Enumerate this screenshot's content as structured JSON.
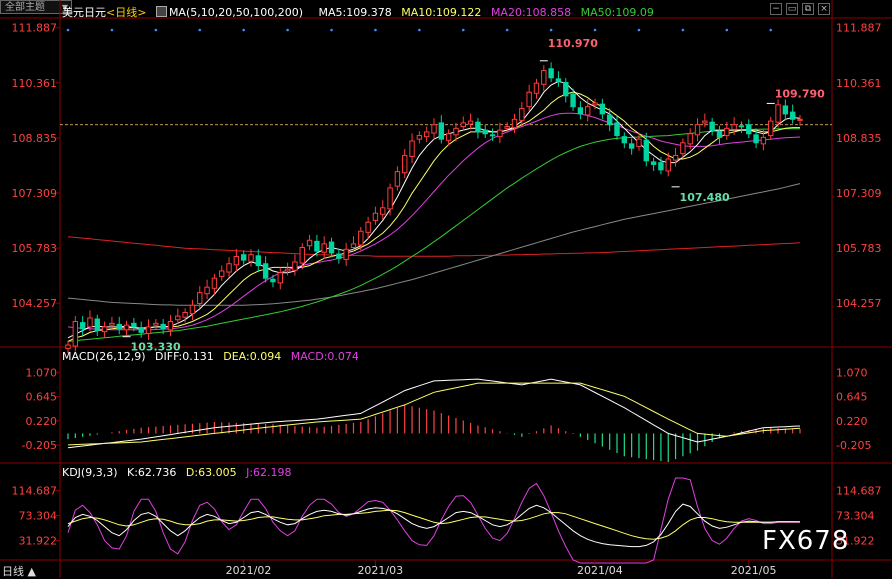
{
  "header": {
    "symbol": "美元日元",
    "period": "<日线>",
    "ma_params": "MA(5,10,20,50,100,200)",
    "ma5": "MA5:109.378",
    "ma10": "MA10:109.122",
    "ma20": "MA20:108.858",
    "ma50": "MA50:109.09",
    "theme_button": "全部主题",
    "theme_caret": "▼"
  },
  "macd_header": {
    "title": "MACD(26,12,9)",
    "diff": "DIFF:0.131",
    "dea": "DEA:0.094",
    "macd": "MACD:0.074"
  },
  "kdj_header": {
    "title": "KDJ(9,3,3)",
    "k": "K:62.736",
    "d": "D:63.005",
    "j": "J:62.198"
  },
  "period_tab": "日线 ▲",
  "watermark": "FX678",
  "colors": {
    "up": "#ff3b3b",
    "down": "#00d4a0",
    "ma5": "#ffffff",
    "ma10": "#ffff66",
    "ma20": "#e040e0",
    "ma50": "#33cc33",
    "ma100": "#888888",
    "ma200": "#dd2222",
    "price_axis": "#ff4040"
  },
  "chart_data": [
    {
      "type": "candlestick",
      "name": "price",
      "y_ticks": [
        "111.887",
        "110.361",
        "108.835",
        "107.309",
        "105.783",
        "104.257"
      ],
      "y_tick_values": [
        111.887,
        110.361,
        108.835,
        107.309,
        105.783,
        104.257
      ],
      "ylim": [
        103.1,
        112.1
      ],
      "x_ticks": [
        "2021/02",
        "2021/03",
        "2021/04",
        "2021/05"
      ],
      "current_price_line": 109.2,
      "annotations": [
        {
          "label": "110.970",
          "value": 110.97
        },
        {
          "label": "103.330",
          "value": 103.33
        },
        {
          "label": "107.480",
          "value": 107.48
        },
        {
          "label": "109.790",
          "value": 109.79
        }
      ],
      "close": [
        103.1,
        103.75,
        103.55,
        103.85,
        103.5,
        103.6,
        103.7,
        103.55,
        103.65,
        103.6,
        103.45,
        103.6,
        103.7,
        103.55,
        103.75,
        103.9,
        104.0,
        104.2,
        104.55,
        104.7,
        104.95,
        105.15,
        105.35,
        105.55,
        105.45,
        105.6,
        105.3,
        104.95,
        104.85,
        105.1,
        105.2,
        105.4,
        105.8,
        106.0,
        105.7,
        105.9,
        105.65,
        105.5,
        105.75,
        105.9,
        106.25,
        106.5,
        106.75,
        106.9,
        107.45,
        107.9,
        108.35,
        108.75,
        108.9,
        109.0,
        109.2,
        108.8,
        108.95,
        109.1,
        109.25,
        109.3,
        109.0,
        108.95,
        108.9,
        109.05,
        109.15,
        109.35,
        109.65,
        110.1,
        110.35,
        110.7,
        110.5,
        110.4,
        110.0,
        109.7,
        109.5,
        109.7,
        109.8,
        109.5,
        109.2,
        108.9,
        108.7,
        108.55,
        108.8,
        108.2,
        108.1,
        107.95,
        108.25,
        108.35,
        108.7,
        108.95,
        109.2,
        109.3,
        109.05,
        108.85,
        109.1,
        109.2,
        109.15,
        108.95,
        108.7,
        108.85,
        109.3,
        109.75,
        109.5,
        109.35,
        109.35
      ],
      "ma5": [
        103.3,
        103.4,
        103.5,
        103.6,
        103.62,
        103.6,
        103.6,
        103.6,
        103.62,
        103.58,
        103.55,
        103.58,
        103.6,
        103.6,
        103.62,
        103.7,
        103.8,
        103.95,
        104.1,
        104.3,
        104.5,
        104.75,
        104.95,
        105.15,
        105.3,
        105.4,
        105.35,
        105.25,
        105.15,
        105.1,
        105.1,
        105.15,
        105.3,
        105.5,
        105.65,
        105.75,
        105.8,
        105.75,
        105.7,
        105.75,
        105.85,
        106.05,
        106.3,
        106.55,
        106.85,
        107.2,
        107.6,
        108.0,
        108.35,
        108.6,
        108.8,
        108.9,
        108.95,
        109.0,
        109.05,
        109.1,
        109.1,
        109.05,
        109.0,
        109.0,
        109.05,
        109.15,
        109.3,
        109.55,
        109.8,
        110.1,
        110.3,
        110.4,
        110.35,
        110.15,
        109.95,
        109.8,
        109.7,
        109.6,
        109.5,
        109.3,
        109.1,
        108.9,
        108.7,
        108.5,
        108.35,
        108.2,
        108.15,
        108.15,
        108.3,
        108.45,
        108.65,
        108.9,
        109.05,
        109.05,
        109.05,
        109.05,
        109.05,
        109.05,
        109.0,
        108.95,
        109.0,
        109.2,
        109.35,
        109.4,
        109.38
      ],
      "ma10": [
        103.2,
        103.3,
        103.35,
        103.45,
        103.5,
        103.52,
        103.55,
        103.57,
        103.58,
        103.58,
        103.58,
        103.58,
        103.6,
        103.6,
        103.6,
        103.62,
        103.68,
        103.75,
        103.85,
        103.95,
        104.1,
        104.3,
        104.5,
        104.7,
        104.9,
        105.05,
        105.15,
        105.2,
        105.25,
        105.25,
        105.25,
        105.25,
        105.25,
        105.3,
        105.4,
        105.5,
        105.55,
        105.6,
        105.65,
        105.7,
        105.8,
        105.9,
        106.05,
        106.2,
        106.4,
        106.65,
        106.95,
        107.3,
        107.6,
        107.9,
        108.2,
        108.45,
        108.65,
        108.8,
        108.9,
        109.0,
        109.0,
        109.0,
        109.0,
        109.0,
        109.05,
        109.1,
        109.2,
        109.3,
        109.45,
        109.6,
        109.8,
        109.95,
        110.05,
        110.1,
        110.05,
        109.95,
        109.8,
        109.7,
        109.6,
        109.45,
        109.3,
        109.1,
        108.95,
        108.8,
        108.6,
        108.45,
        108.35,
        108.25,
        108.25,
        108.3,
        108.4,
        108.55,
        108.7,
        108.85,
        108.95,
        109.0,
        109.05,
        109.05,
        109.05,
        109.0,
        109.0,
        109.05,
        109.1,
        109.12,
        109.12
      ],
      "ma20": [
        103.6,
        103.58,
        103.56,
        103.55,
        103.54,
        103.53,
        103.52,
        103.52,
        103.52,
        103.52,
        103.52,
        103.52,
        103.53,
        103.54,
        103.55,
        103.57,
        103.6,
        103.65,
        103.72,
        103.8,
        103.9,
        104.02,
        104.15,
        104.3,
        104.45,
        104.6,
        104.75,
        104.88,
        105.0,
        105.1,
        105.18,
        105.25,
        105.3,
        105.35,
        105.38,
        105.42,
        105.45,
        105.5,
        105.55,
        105.62,
        105.7,
        105.8,
        105.9,
        106.02,
        106.15,
        106.3,
        106.48,
        106.68,
        106.9,
        107.12,
        107.35,
        107.58,
        107.8,
        108.0,
        108.2,
        108.38,
        108.55,
        108.7,
        108.82,
        108.92,
        109.0,
        109.08,
        109.15,
        109.22,
        109.3,
        109.38,
        109.45,
        109.5,
        109.52,
        109.52,
        109.5,
        109.45,
        109.4,
        109.32,
        109.25,
        109.18,
        109.1,
        109.02,
        108.95,
        108.88,
        108.82,
        108.75,
        108.7,
        108.66,
        108.62,
        108.6,
        108.6,
        108.6,
        108.62,
        108.65,
        108.68,
        108.7,
        108.72,
        108.74,
        108.76,
        108.78,
        108.8,
        108.82,
        108.84,
        108.85,
        108.86
      ],
      "ma50": [
        103.2,
        103.22,
        103.24,
        103.26,
        103.28,
        103.3,
        103.32,
        103.34,
        103.36,
        103.38,
        103.4,
        103.42,
        103.44,
        103.46,
        103.48,
        103.5,
        103.53,
        103.56,
        103.59,
        103.62,
        103.66,
        103.7,
        103.74,
        103.78,
        103.82,
        103.86,
        103.9,
        103.94,
        103.98,
        104.02,
        104.07,
        104.12,
        104.17,
        104.23,
        104.29,
        104.36,
        104.43,
        104.5,
        104.58,
        104.66,
        104.75,
        104.85,
        104.95,
        105.06,
        105.17,
        105.29,
        105.42,
        105.55,
        105.68,
        105.82,
        105.96,
        106.1,
        106.25,
        106.4,
        106.55,
        106.7,
        106.85,
        107.0,
        107.15,
        107.3,
        107.45,
        107.58,
        107.72,
        107.85,
        107.98,
        108.1,
        108.22,
        108.33,
        108.43,
        108.52,
        108.6,
        108.66,
        108.72,
        108.76,
        108.8,
        108.82,
        108.84,
        108.85,
        108.86,
        108.87,
        108.88,
        108.89,
        108.9,
        108.92,
        108.94,
        108.96,
        108.98,
        109.0,
        109.02,
        109.03,
        109.04,
        109.05,
        109.06,
        109.07,
        109.07,
        109.08,
        109.08,
        109.09,
        109.09,
        109.09,
        109.09
      ],
      "ma100": [
        104.4,
        104.38,
        104.36,
        104.34,
        104.32,
        104.3,
        104.28,
        104.27,
        104.26,
        104.25,
        104.24,
        104.23,
        104.22,
        104.21,
        104.21,
        104.2,
        104.2,
        104.2,
        104.2,
        104.2,
        104.2,
        104.2,
        104.2,
        104.2,
        104.2,
        104.21,
        104.22,
        104.23,
        104.24,
        104.26,
        104.28,
        104.3,
        104.32,
        104.34,
        104.37,
        104.4,
        104.43,
        104.46,
        104.5,
        104.54,
        104.58,
        104.62,
        104.66,
        104.71,
        104.76,
        104.81,
        104.86,
        104.91,
        104.97,
        105.03,
        105.09,
        105.15,
        105.21,
        105.27,
        105.33,
        105.39,
        105.45,
        105.51,
        105.57,
        105.63,
        105.69,
        105.75,
        105.81,
        105.87,
        105.93,
        105.99,
        106.05,
        106.11,
        106.17,
        106.23,
        106.28,
        106.33,
        106.38,
        106.43,
        106.48,
        106.53,
        106.58,
        106.62,
        106.66,
        106.7,
        106.74,
        106.78,
        106.82,
        106.86,
        106.9,
        106.94,
        106.98,
        107.02,
        107.06,
        107.1,
        107.14,
        107.18,
        107.22,
        107.26,
        107.3,
        107.34,
        107.38,
        107.42,
        107.47,
        107.52,
        107.57
      ],
      "ma200": [
        106.1,
        106.08,
        106.06,
        106.04,
        106.02,
        106.0,
        105.98,
        105.96,
        105.94,
        105.92,
        105.9,
        105.88,
        105.86,
        105.84,
        105.82,
        105.8,
        105.78,
        105.77,
        105.76,
        105.75,
        105.74,
        105.73,
        105.72,
        105.71,
        105.7,
        105.69,
        105.68,
        105.67,
        105.66,
        105.65,
        105.64,
        105.63,
        105.62,
        105.61,
        105.6,
        105.6,
        105.59,
        105.59,
        105.58,
        105.58,
        105.57,
        105.57,
        105.56,
        105.56,
        105.56,
        105.56,
        105.56,
        105.56,
        105.56,
        105.56,
        105.56,
        105.56,
        105.56,
        105.57,
        105.57,
        105.57,
        105.58,
        105.58,
        105.58,
        105.59,
        105.59,
        105.6,
        105.6,
        105.61,
        105.61,
        105.62,
        105.62,
        105.63,
        105.63,
        105.64,
        105.64,
        105.65,
        105.65,
        105.66,
        105.67,
        105.68,
        105.69,
        105.7,
        105.71,
        105.72,
        105.73,
        105.74,
        105.75,
        105.76,
        105.77,
        105.78,
        105.79,
        105.8,
        105.81,
        105.82,
        105.83,
        105.84,
        105.85,
        105.86,
        105.87,
        105.88,
        105.89,
        105.9,
        105.91,
        105.92,
        105.93
      ]
    },
    {
      "type": "line",
      "name": "MACD",
      "y_ticks": [
        "1.070",
        "0.645",
        "0.220",
        "-0.205"
      ],
      "y_tick_values": [
        1.07,
        0.645,
        0.22,
        -0.205
      ],
      "ylim": [
        -0.5,
        1.25
      ],
      "series_names": [
        "DIFF",
        "DEA",
        "MACD"
      ],
      "diff_key_points": [
        [
          0,
          -0.25
        ],
        [
          10,
          -0.1
        ],
        [
          20,
          0.1
        ],
        [
          28,
          0.2
        ],
        [
          34,
          0.25
        ],
        [
          40,
          0.35
        ],
        [
          46,
          0.75
        ],
        [
          50,
          0.92
        ],
        [
          56,
          0.95
        ],
        [
          62,
          0.85
        ],
        [
          66,
          0.95
        ],
        [
          70,
          0.85
        ],
        [
          76,
          0.45
        ],
        [
          82,
          0.0
        ],
        [
          86,
          -0.15
        ],
        [
          90,
          -0.05
        ],
        [
          95,
          0.1
        ],
        [
          100,
          0.13
        ]
      ],
      "dea_key_points": [
        [
          0,
          -0.2
        ],
        [
          10,
          -0.15
        ],
        [
          20,
          0.0
        ],
        [
          28,
          0.12
        ],
        [
          34,
          0.2
        ],
        [
          40,
          0.25
        ],
        [
          46,
          0.5
        ],
        [
          50,
          0.72
        ],
        [
          56,
          0.88
        ],
        [
          62,
          0.88
        ],
        [
          66,
          0.88
        ],
        [
          70,
          0.88
        ],
        [
          76,
          0.65
        ],
        [
          82,
          0.25
        ],
        [
          86,
          0.0
        ],
        [
          90,
          -0.05
        ],
        [
          95,
          0.05
        ],
        [
          100,
          0.09
        ]
      ]
    },
    {
      "type": "line",
      "name": "KDJ",
      "y_ticks": [
        "114.687",
        "73.304",
        "31.922"
      ],
      "y_tick_values": [
        114.687,
        73.304,
        31.922
      ],
      "ylim": [
        0,
        135
      ],
      "series_names": [
        "K",
        "D",
        "J"
      ],
      "k": [
        55,
        70,
        75,
        72,
        65,
        55,
        45,
        40,
        50,
        65,
        75,
        78,
        72,
        60,
        48,
        40,
        48,
        60,
        70,
        75,
        72,
        65,
        60,
        62,
        70,
        78,
        80,
        75,
        68,
        62,
        58,
        60,
        68,
        75,
        80,
        82,
        80,
        76,
        74,
        76,
        80,
        84,
        86,
        85,
        82,
        76,
        68,
        60,
        55,
        52,
        55,
        62,
        70,
        78,
        80,
        78,
        72,
        65,
        58,
        55,
        58,
        65,
        75,
        85,
        90,
        86,
        78,
        68,
        58,
        48,
        40,
        34,
        30,
        27,
        25,
        24,
        23,
        22,
        22,
        24,
        30,
        42,
        60,
        80,
        92,
        88,
        76,
        64,
        56,
        52,
        54,
        58,
        62,
        64,
        63,
        62,
        62,
        63,
        63,
        63,
        62.7
      ],
      "d": [
        60,
        64,
        68,
        70,
        69,
        66,
        62,
        58,
        56,
        58,
        62,
        66,
        68,
        67,
        64,
        60,
        58,
        58,
        60,
        64,
        66,
        66,
        65,
        64,
        65,
        67,
        70,
        71,
        71,
        69,
        67,
        66,
        66,
        68,
        70,
        73,
        74,
        75,
        75,
        76,
        77,
        78,
        80,
        81,
        82,
        81,
        78,
        74,
        70,
        66,
        62,
        60,
        61,
        64,
        67,
        70,
        71,
        71,
        69,
        67,
        65,
        64,
        65,
        68,
        72,
        76,
        78,
        78,
        76,
        72,
        68,
        64,
        60,
        56,
        52,
        48,
        44,
        40,
        37,
        35,
        34,
        36,
        40,
        48,
        58,
        66,
        70,
        70,
        68,
        65,
        63,
        62,
        62,
        62,
        62,
        62,
        62,
        63,
        63,
        63,
        63.0
      ],
      "j": [
        45,
        82,
        90,
        78,
        58,
        32,
        20,
        18,
        40,
        80,
        100,
        100,
        80,
        45,
        18,
        10,
        30,
        65,
        90,
        95,
        84,
        63,
        50,
        58,
        80,
        100,
        100,
        85,
        62,
        48,
        40,
        48,
        72,
        90,
        100,
        100,
        92,
        78,
        72,
        76,
        86,
        96,
        98,
        95,
        82,
        66,
        48,
        32,
        25,
        24,
        40,
        66,
        88,
        105,
        106,
        95,
        74,
        52,
        36,
        32,
        44,
        68,
        95,
        118,
        126,
        106,
        78,
        48,
        22,
        0,
        -15,
        -25,
        -32,
        -35,
        -35,
        -32,
        -30,
        -28,
        -25,
        -18,
        0,
        50,
        100,
        144,
        160,
        132,
        88,
        52,
        32,
        26,
        36,
        52,
        64,
        68,
        65,
        60,
        60,
        62,
        62,
        62,
        62.2
      ]
    }
  ]
}
